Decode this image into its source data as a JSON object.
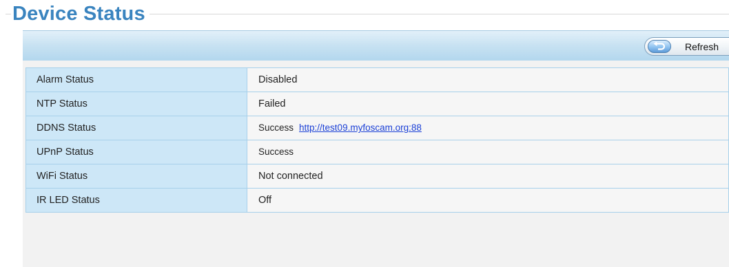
{
  "page": {
    "title": "Device Status"
  },
  "toolbar": {
    "refresh_label": "Refresh",
    "refresh_icon": "refresh-arrow-icon"
  },
  "status_rows": [
    {
      "label": "Alarm Status",
      "value": "Disabled"
    },
    {
      "label": "NTP Status",
      "value": "Failed"
    },
    {
      "label": "DDNS Status",
      "value": "Success",
      "link": "http://test09.myfoscam.org:88"
    },
    {
      "label": "UPnP Status",
      "value": "Success"
    },
    {
      "label": "WiFi Status",
      "value": "Not connected"
    },
    {
      "label": "IR LED Status",
      "value": "Off"
    }
  ],
  "colors": {
    "title": "#3a84bf",
    "toolbar": "#c8e2f2",
    "label_cell": "#cde7f7",
    "value_cell": "#f6f6f6",
    "border": "#a7d0ea",
    "link": "#1a3fd6"
  }
}
